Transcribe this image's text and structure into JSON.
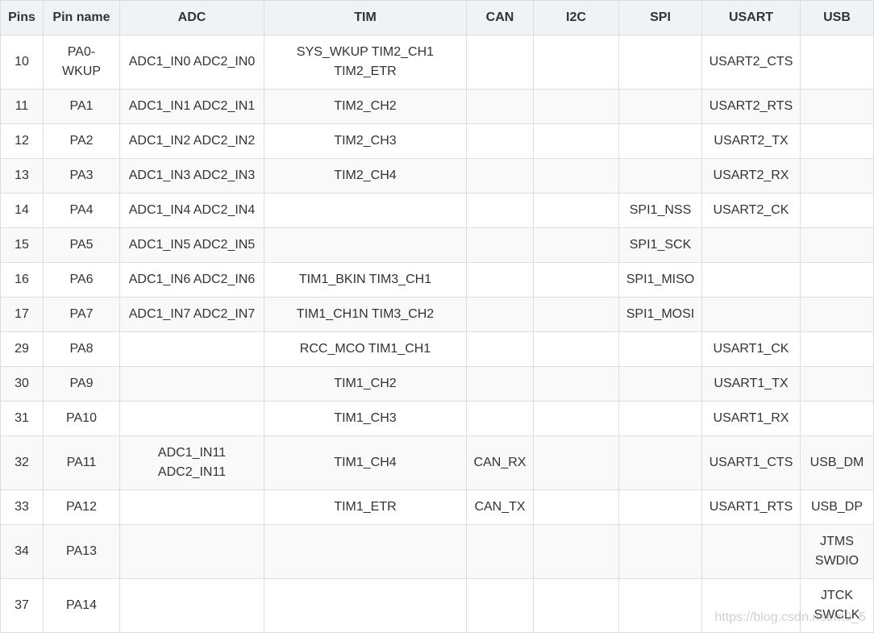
{
  "table": {
    "headers": [
      "Pins",
      "Pin name",
      "ADC",
      "TIM",
      "CAN",
      "I2C",
      "SPI",
      "USART",
      "USB"
    ],
    "rows": [
      [
        "10",
        "PA0-WKUP",
        "ADC1_IN0 ADC2_IN0",
        "SYS_WKUP TIM2_CH1 TIM2_ETR",
        "",
        "",
        "",
        "USART2_CTS",
        ""
      ],
      [
        "11",
        "PA1",
        "ADC1_IN1 ADC2_IN1",
        "TIM2_CH2",
        "",
        "",
        "",
        "USART2_RTS",
        ""
      ],
      [
        "12",
        "PA2",
        "ADC1_IN2 ADC2_IN2",
        "TIM2_CH3",
        "",
        "",
        "",
        "USART2_TX",
        ""
      ],
      [
        "13",
        "PA3",
        "ADC1_IN3 ADC2_IN3",
        "TIM2_CH4",
        "",
        "",
        "",
        "USART2_RX",
        ""
      ],
      [
        "14",
        "PA4",
        "ADC1_IN4 ADC2_IN4",
        "",
        "",
        "",
        "SPI1_NSS",
        "USART2_CK",
        ""
      ],
      [
        "15",
        "PA5",
        "ADC1_IN5 ADC2_IN5",
        "",
        "",
        "",
        "SPI1_SCK",
        "",
        ""
      ],
      [
        "16",
        "PA6",
        "ADC1_IN6 ADC2_IN6",
        "TIM1_BKIN TIM3_CH1",
        "",
        "",
        "SPI1_MISO",
        "",
        ""
      ],
      [
        "17",
        "PA7",
        "ADC1_IN7 ADC2_IN7",
        "TIM1_CH1N TIM3_CH2",
        "",
        "",
        "SPI1_MOSI",
        "",
        ""
      ],
      [
        "29",
        "PA8",
        "",
        "RCC_MCO TIM1_CH1",
        "",
        "",
        "",
        "USART1_CK",
        ""
      ],
      [
        "30",
        "PA9",
        "",
        "TIM1_CH2",
        "",
        "",
        "",
        "USART1_TX",
        ""
      ],
      [
        "31",
        "PA10",
        "",
        "TIM1_CH3",
        "",
        "",
        "",
        "USART1_RX",
        ""
      ],
      [
        "32",
        "PA11",
        "ADC1_IN11 ADC2_IN11",
        "TIM1_CH4",
        "CAN_RX",
        "",
        "",
        "USART1_CTS",
        "USB_DM"
      ],
      [
        "33",
        "PA12",
        "",
        "TIM1_ETR",
        "CAN_TX",
        "",
        "",
        "USART1_RTS",
        "USB_DP"
      ],
      [
        "34",
        "PA13",
        "",
        "",
        "",
        "",
        "",
        "",
        "JTMS SWDIO"
      ],
      [
        "37",
        "PA14",
        "",
        "",
        "",
        "",
        "",
        "",
        "JTCK SWCLK"
      ]
    ]
  },
  "watermark": "https://blog.csdn.net/m0_5"
}
